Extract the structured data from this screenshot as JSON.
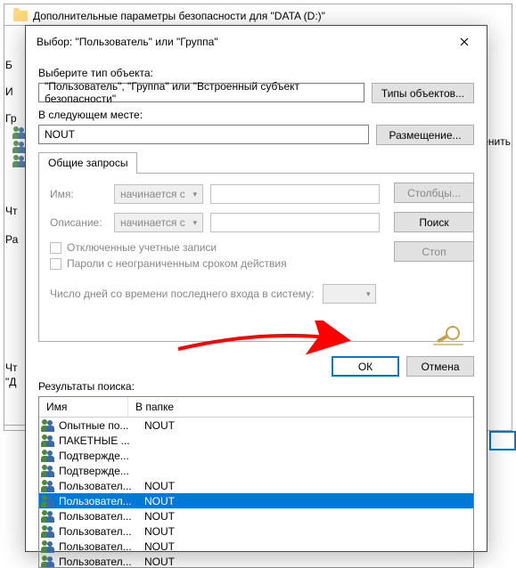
{
  "bg_window": {
    "title": "Дополнительные параметры безопасности  для \"DATA (D:)\""
  },
  "bg_labels": {
    "b": "Б",
    "i": "И",
    "g": "Гр",
    "chto": "Чт",
    "pa": "Ра",
    "chto2": "Чт",
    "d": "\"Д",
    "menit": "менить"
  },
  "dialog": {
    "title": "Выбор: \"Пользователь\" или \"Группа\"",
    "object_type_label": "Выберите тип объекта:",
    "object_type_value": "\"Пользователь\", \"Группа\" или \"Встроенный субъект безопасности\"",
    "object_type_btn": "Типы объектов...",
    "location_label": "В следующем месте:",
    "location_value": "NOUT",
    "location_btn": "Размещение...",
    "tab_label": "Общие запросы",
    "columns_btn": "Столбцы...",
    "find_btn": "Поиск",
    "stop_btn": "Стоп",
    "name_label": "Имя:",
    "desc_label": "Описание:",
    "starts_with": "начинается с",
    "chk_disabled": "Отключенные учетные записи",
    "chk_pwd": "Пароли с неограниченным сроком действия",
    "days_label": "Число дней со времени последнего входа в систему:",
    "ok": "ОК",
    "cancel": "Отмена",
    "results_label": "Результаты поиска:",
    "col_name": "Имя",
    "col_folder": "В папке",
    "rows": [
      {
        "name": "Опытные по...",
        "folder": "NOUT"
      },
      {
        "name": "ПАКЕТНЫЕ ...",
        "folder": ""
      },
      {
        "name": "Подтвержде...",
        "folder": ""
      },
      {
        "name": "Подтвержде...",
        "folder": ""
      },
      {
        "name": "Пользовател...",
        "folder": "NOUT"
      },
      {
        "name": "Пользовател...",
        "folder": "NOUT",
        "selected": true
      },
      {
        "name": "Пользовател...",
        "folder": "NOUT"
      },
      {
        "name": "Пользовател...",
        "folder": "NOUT"
      },
      {
        "name": "Пользовател...",
        "folder": "NOUT"
      },
      {
        "name": "Пользовател...",
        "folder": "NOUT"
      }
    ]
  }
}
